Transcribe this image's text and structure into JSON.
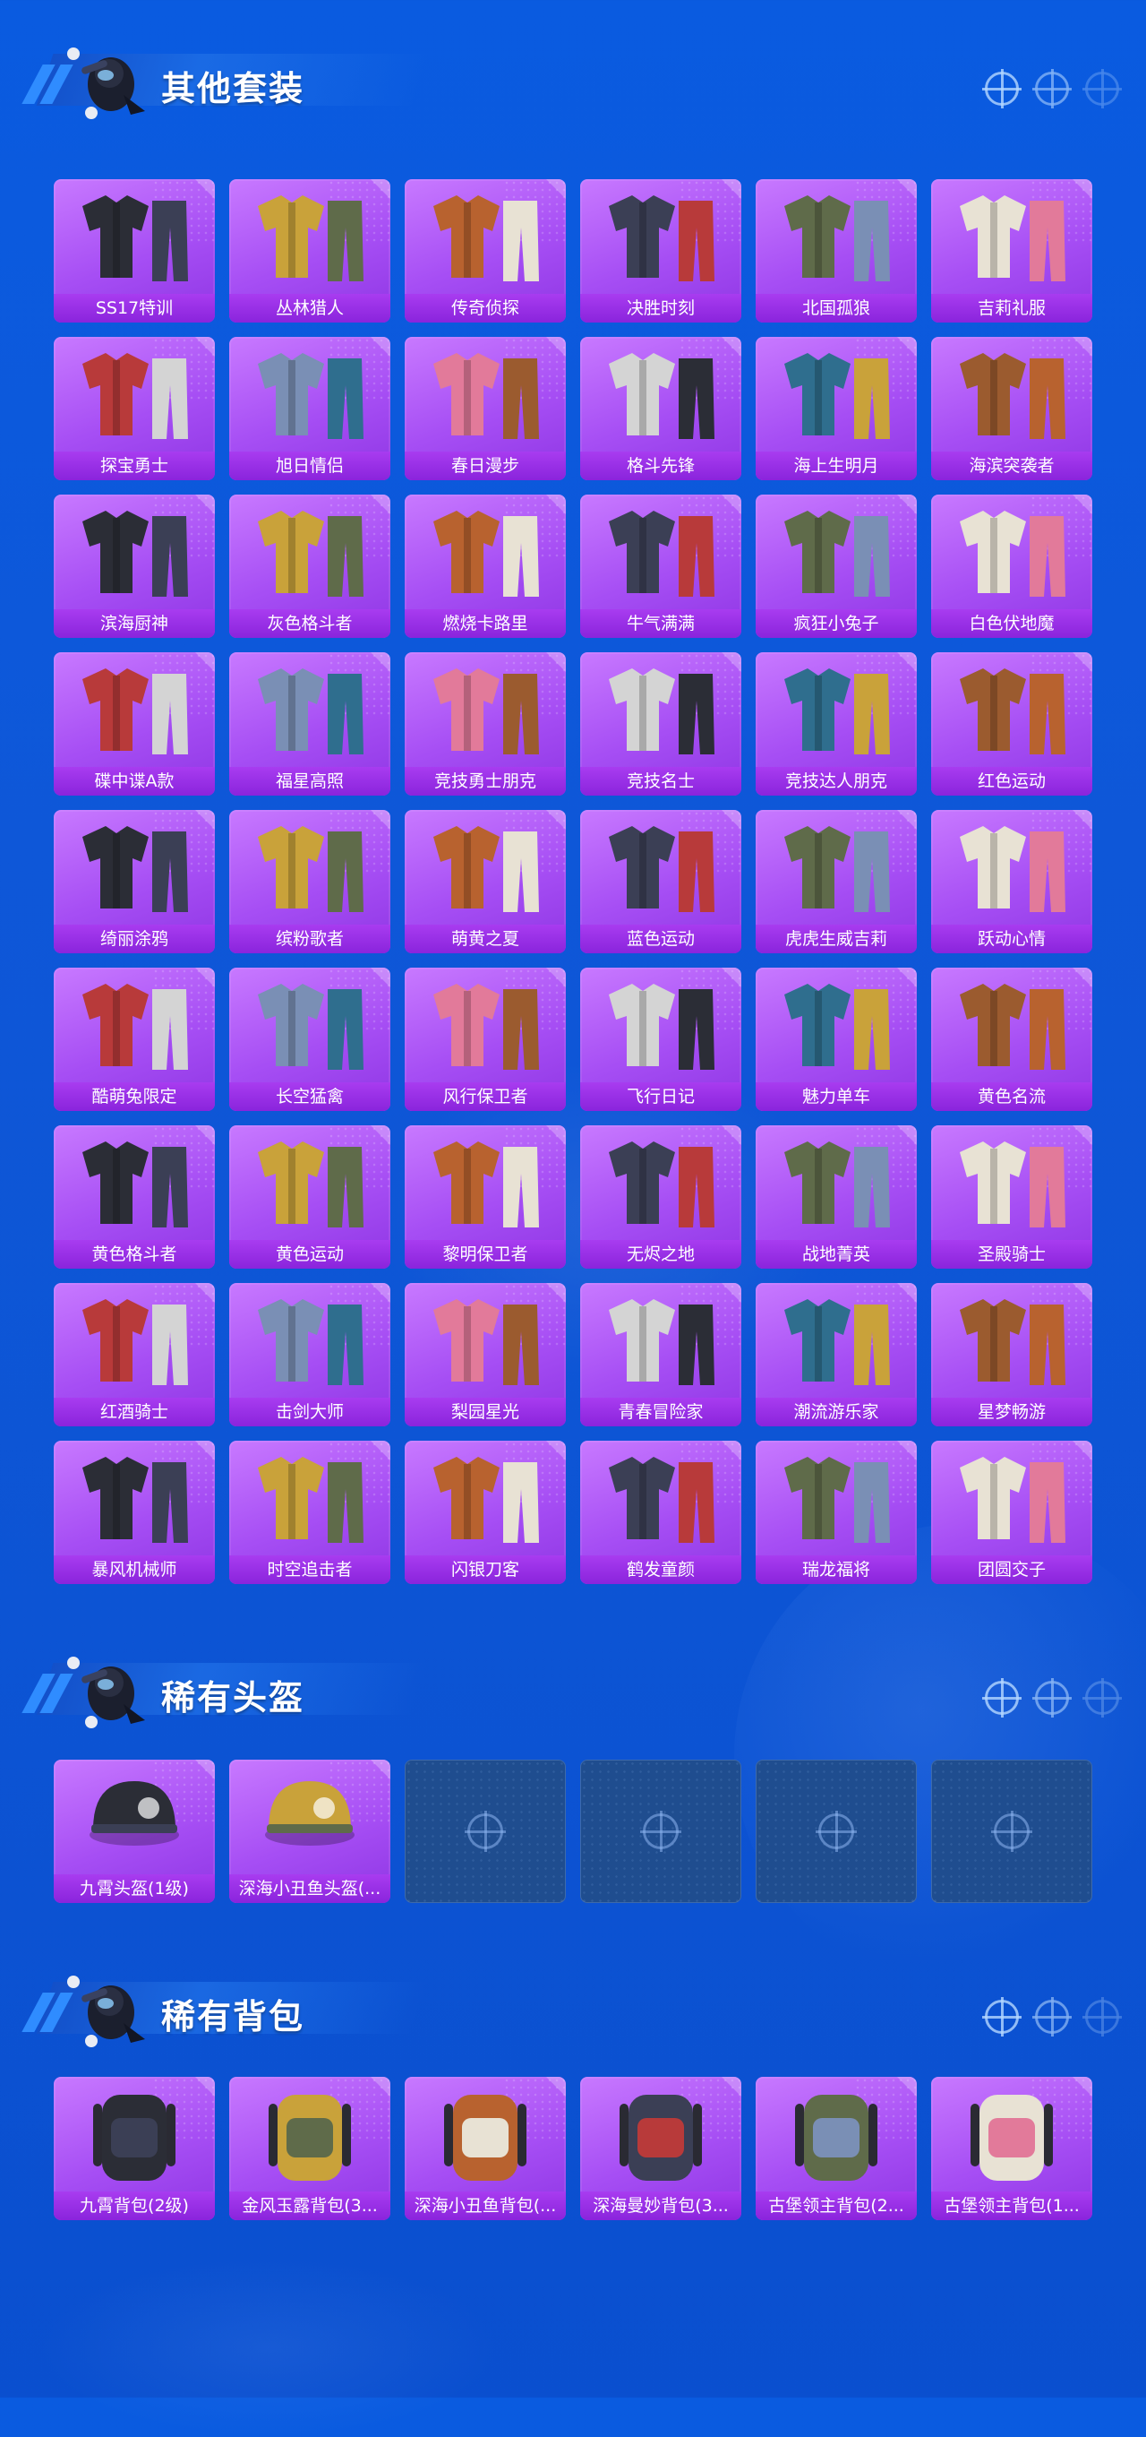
{
  "sections": [
    {
      "title": "其他套装",
      "items": [
        {
          "label": "SS17特训"
        },
        {
          "label": "丛林猎人"
        },
        {
          "label": "传奇侦探"
        },
        {
          "label": "决胜时刻"
        },
        {
          "label": "北国孤狼"
        },
        {
          "label": "吉莉礼服"
        },
        {
          "label": "探宝勇士"
        },
        {
          "label": "旭日情侣"
        },
        {
          "label": "春日漫步"
        },
        {
          "label": "格斗先锋"
        },
        {
          "label": "海上生明月"
        },
        {
          "label": "海滨突袭者"
        },
        {
          "label": "滨海厨神"
        },
        {
          "label": "灰色格斗者"
        },
        {
          "label": "燃烧卡路里"
        },
        {
          "label": "牛气满满"
        },
        {
          "label": "疯狂小兔子"
        },
        {
          "label": "白色伏地魔"
        },
        {
          "label": "碟中谍A款"
        },
        {
          "label": "福星高照"
        },
        {
          "label": "竞技勇士朋克"
        },
        {
          "label": "竞技名士"
        },
        {
          "label": "竞技达人朋克"
        },
        {
          "label": "红色运动"
        },
        {
          "label": "绮丽涂鸦"
        },
        {
          "label": "缤粉歌者"
        },
        {
          "label": "萌黄之夏"
        },
        {
          "label": "蓝色运动"
        },
        {
          "label": "虎虎生威吉莉"
        },
        {
          "label": "跃动心情"
        },
        {
          "label": "酷萌兔限定"
        },
        {
          "label": "长空猛禽"
        },
        {
          "label": "风行保卫者"
        },
        {
          "label": "飞行日记"
        },
        {
          "label": "魅力单车"
        },
        {
          "label": "黄色名流"
        },
        {
          "label": "黄色格斗者"
        },
        {
          "label": "黄色运动"
        },
        {
          "label": "黎明保卫者"
        },
        {
          "label": "无烬之地"
        },
        {
          "label": "战地菁英"
        },
        {
          "label": "圣殿骑士"
        },
        {
          "label": "红酒骑士"
        },
        {
          "label": "击剑大师"
        },
        {
          "label": "梨园星光"
        },
        {
          "label": "青春冒险家"
        },
        {
          "label": "潮流游乐家"
        },
        {
          "label": "星梦畅游"
        },
        {
          "label": "暴风机械师"
        },
        {
          "label": "时空追击者"
        },
        {
          "label": "闪银刀客"
        },
        {
          "label": "鹤发童颜"
        },
        {
          "label": "瑞龙福将"
        },
        {
          "label": "团圆交子"
        }
      ]
    },
    {
      "title": "稀有头盔",
      "items": [
        {
          "label": "九霄头盔(1级)"
        },
        {
          "label": "深海小丑鱼头盔(..."
        }
      ],
      "empty_slots": 4
    },
    {
      "title": "稀有背包",
      "items": [
        {
          "label": "九霄背包(2级)"
        },
        {
          "label": "金风玉露背包(3..."
        },
        {
          "label": "深海小丑鱼背包(..."
        },
        {
          "label": "深海曼妙背包(3..."
        },
        {
          "label": "古堡领主背包(2..."
        },
        {
          "label": "古堡领主背包(1..."
        }
      ]
    }
  ],
  "colors": {
    "background": "#0d55d5",
    "card_purple": "#a64ef4",
    "label_bar": "#8a24dc",
    "empty_slot": "#1f4d8f"
  },
  "icons": {
    "header_mascot": "mascot-icon",
    "header_decor": "crosshair-icon"
  }
}
